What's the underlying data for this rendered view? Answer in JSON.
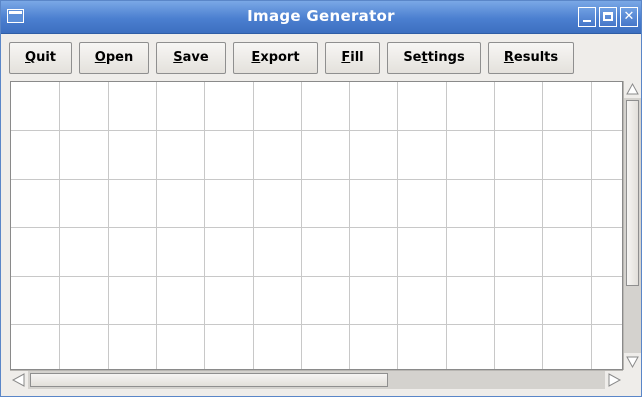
{
  "window": {
    "title": "Image Generator"
  },
  "toolbar": {
    "buttons": [
      {
        "label_pre": "",
        "label_u": "Q",
        "label_post": "uit"
      },
      {
        "label_pre": "",
        "label_u": "O",
        "label_post": "pen"
      },
      {
        "label_pre": "",
        "label_u": "S",
        "label_post": "ave"
      },
      {
        "label_pre": "",
        "label_u": "E",
        "label_post": "xport"
      },
      {
        "label_pre": "",
        "label_u": "F",
        "label_post": "ill"
      },
      {
        "label_pre": "Se",
        "label_u": "t",
        "label_post": "tings"
      },
      {
        "label_pre": "",
        "label_u": "R",
        "label_post": "esults"
      }
    ]
  },
  "canvas": {
    "grid_columns": 13,
    "grid_rows": 6,
    "grid_color": "#c8c8c8",
    "background": "#ffffff"
  },
  "scroll": {
    "vertical_position": 0,
    "horizontal_position": 0,
    "vertical_visible_fraction": 0.67,
    "horizontal_visible_fraction": 0.62
  },
  "colors": {
    "titlebar": "#4b7fd0",
    "window_bg": "#efedea"
  },
  "icons": {
    "window_menu": "window-menu-icon",
    "minimize": "minimize-icon",
    "maximize": "maximize-icon",
    "close": "close-icon",
    "scroll_up": "arrow-up-icon",
    "scroll_down": "arrow-down-icon",
    "scroll_left": "arrow-left-icon",
    "scroll_right": "arrow-right-icon"
  }
}
